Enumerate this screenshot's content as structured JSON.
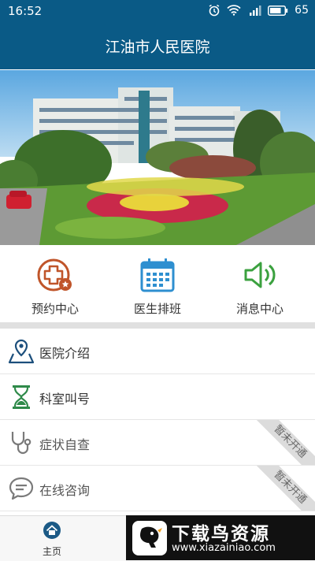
{
  "status_bar": {
    "time": "16:52",
    "battery": "65",
    "network": "4G"
  },
  "header": {
    "title": "江油市人民医院"
  },
  "banner": {
    "slide_count": 5,
    "active_index": 0
  },
  "quick_actions": [
    {
      "label": "预约中心",
      "icon": "add-appointment-icon",
      "color": "#c0552a"
    },
    {
      "label": "医生排班",
      "icon": "calendar-icon",
      "color": "#2e8fd0"
    },
    {
      "label": "消息中心",
      "icon": "speaker-icon",
      "color": "#3ba13f"
    }
  ],
  "menu": [
    {
      "label": "医院介绍",
      "icon": "location-map-icon",
      "enabled": true
    },
    {
      "label": "科室叫号",
      "icon": "hourglass-icon",
      "enabled": true
    },
    {
      "label": "症状自查",
      "icon": "stethoscope-icon",
      "enabled": false,
      "ribbon": "暂未开通"
    },
    {
      "label": "在线咨询",
      "icon": "chat-bubble-icon",
      "enabled": false,
      "ribbon": "暂未开通"
    }
  ],
  "tab_bar": {
    "home_label": "主页"
  },
  "watermark": {
    "title": "下载鸟资源",
    "url": "www.xiazainiao.com"
  }
}
